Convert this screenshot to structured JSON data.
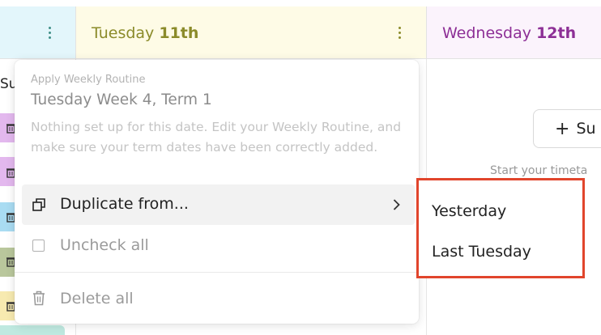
{
  "header": {
    "tuesday": {
      "day": "Tuesday",
      "date": "11th"
    },
    "wednesday": {
      "day": "Wednesday",
      "date": "12th"
    }
  },
  "left_strip": {
    "truncated_label": "Su"
  },
  "wednesday_panel": {
    "add_button_label": "Su",
    "start_text": "Start your timeta"
  },
  "menu": {
    "section_label": "Apply Weekly Routine",
    "week_label": "Tuesday Week 4, Term 1",
    "note": "Nothing set up for this date. Edit your Weekly Routine, and make sure your term dates have been correctly added.",
    "duplicate_label": "Duplicate from...",
    "uncheck_label": "Uncheck all",
    "delete_label": "Delete all"
  },
  "submenu": {
    "items": [
      "Yesterday",
      "Last Tuesday"
    ]
  },
  "colors": {
    "tuesday_title": "#8b8b2a",
    "wednesday_title": "#8d2f96",
    "kebab_dots": "#4a9a8f",
    "submenu_highlight": "#e1452c"
  }
}
